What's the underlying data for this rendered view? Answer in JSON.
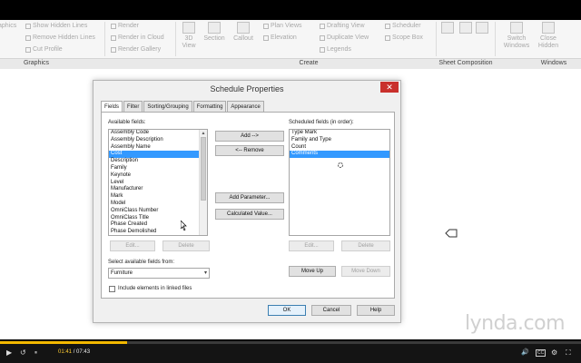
{
  "ribbon": {
    "graphics_items": [
      "aphics",
      "Show Hidden Lines",
      "Remove Hidden Lines",
      "Cut Profile"
    ],
    "render_items": [
      "Render",
      "Render in Cloud",
      "Render Gallery"
    ],
    "create_big": [
      "3D View",
      "Section",
      "Callout"
    ],
    "create_items": [
      "Plan Views",
      "Elevation",
      "Drafting View",
      "Duplicate View",
      "Legends",
      "Scheduler",
      "Scope Box"
    ],
    "window_items": [
      "Switch Windows",
      "Close Hidden"
    ],
    "groups": [
      "Graphics",
      "Create",
      "Sheet Composition",
      "Windows"
    ]
  },
  "dialog": {
    "title": "Schedule Properties",
    "close_glyph": "✕",
    "tabs": [
      "Fields",
      "Filter",
      "Sorting/Grouping",
      "Formatting",
      "Appearance"
    ],
    "available_label": "Available fields:",
    "available_fields": [
      "Assembly Code",
      "Assembly Description",
      "Assembly Name",
      "Cost",
      "Description",
      "Family",
      "Keynote",
      "Level",
      "Manufacturer",
      "Mark",
      "Model",
      "OmniClass Number",
      "OmniClass Title",
      "Phase Created",
      "Phase Demolished"
    ],
    "available_selected": "Cost",
    "scheduled_label": "Scheduled fields (in order):",
    "scheduled_fields": [
      "Type Mark",
      "Family and Type",
      "Count",
      "Comments"
    ],
    "scheduled_selected": "Comments",
    "add_btn": "Add -->",
    "remove_btn": "<-- Remove",
    "add_param_btn": "Add Parameter...",
    "calc_value_btn": "Calculated Value...",
    "edit_btn": "Edit...",
    "delete_btn": "Delete",
    "select_from_label": "Select available fields from:",
    "select_from_value": "Furniture",
    "move_up_btn": "Move Up",
    "move_down_btn": "Move Down",
    "linked_label": "Include elements in linked files",
    "ok_btn": "OK",
    "cancel_btn": "Cancel",
    "help_btn": "Help"
  },
  "brand": "lynda.com",
  "player": {
    "current_time": "01:41",
    "separator": "/",
    "total_time": "07:43",
    "progress_fraction": 0.218,
    "play_glyph": "▶",
    "back_glyph": "↺",
    "pause_glyph": "⏸",
    "volume_glyph": "🔊",
    "cc_glyph": "CC",
    "settings_glyph": "⚙",
    "fullscreen_glyph": "⛶",
    "accent_color": "#f3b800"
  }
}
